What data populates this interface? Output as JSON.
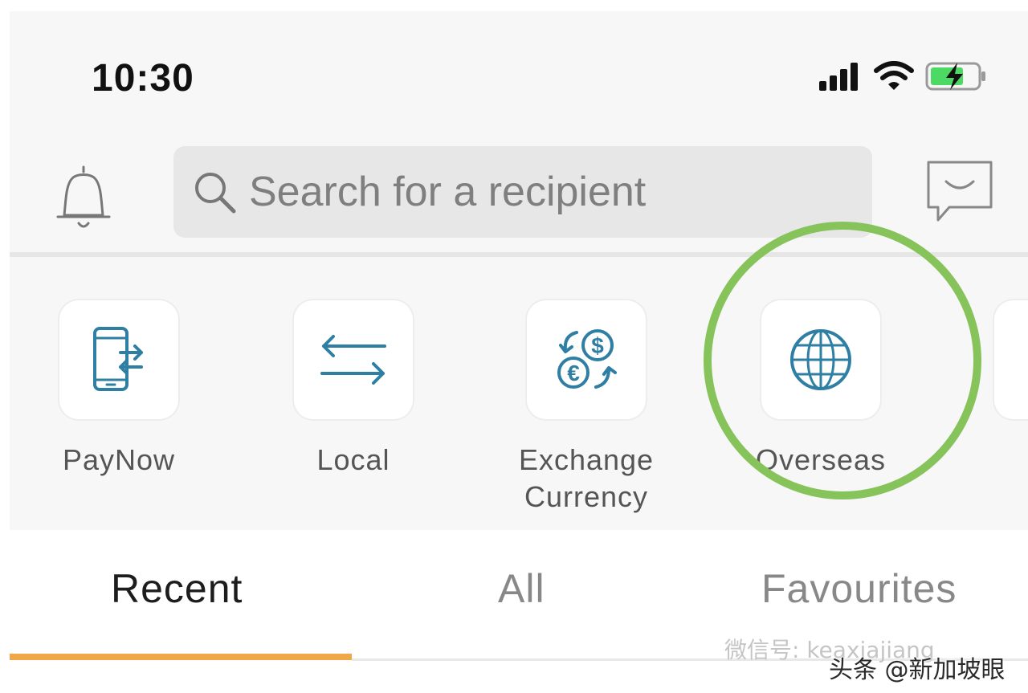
{
  "status_bar": {
    "time": "10:30",
    "icons": [
      "signal-icon",
      "wifi-icon",
      "battery-charging-icon"
    ]
  },
  "header": {
    "notifications_icon": "bell-icon",
    "search": {
      "placeholder": "Search for a recipient",
      "value": ""
    },
    "chat_icon": "chat-icon"
  },
  "actions": [
    {
      "label": "PayNow",
      "icon": "phone-transfer-icon"
    },
    {
      "label": "Local",
      "icon": "transfer-arrows-icon"
    },
    {
      "label": "Exchange Currency",
      "icon": "currency-exchange-icon"
    },
    {
      "label": "Overseas",
      "icon": "globe-icon",
      "highlighted": true
    }
  ],
  "tabs": [
    {
      "label": "Recent",
      "active": true
    },
    {
      "label": "All",
      "active": false
    },
    {
      "label": "Favourites",
      "active": false
    }
  ],
  "watermark": {
    "line1": "微信号: keaxiajiang",
    "line2": "头条 @新加坡眼"
  },
  "colors": {
    "accent": "#f0a74a",
    "icon_blue": "#2e7fa3",
    "highlight_ring": "#86c35a",
    "battery_green": "#4cd964"
  }
}
